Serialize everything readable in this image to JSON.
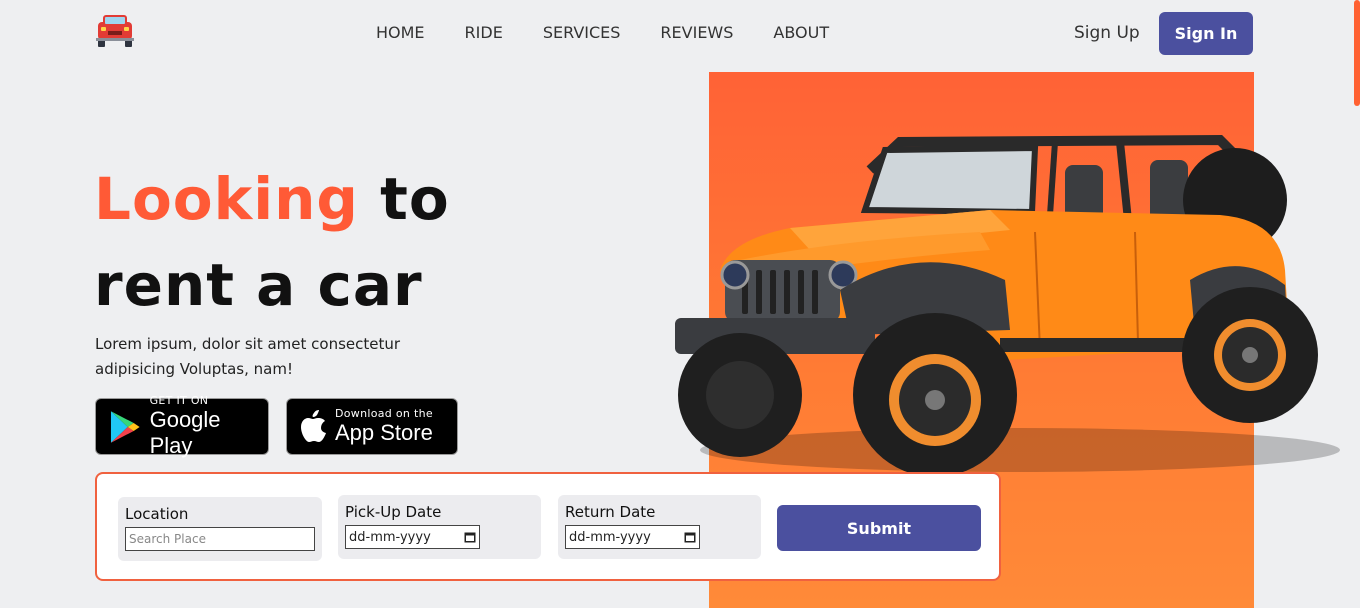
{
  "nav": {
    "items": [
      "HOME",
      "RIDE",
      "SERVICES",
      "REVIEWS",
      "ABOUT"
    ],
    "signup": "Sign Up",
    "signin": "Sign In"
  },
  "hero": {
    "title_accent": "Looking",
    "title_rest1": " to",
    "title_line2": "rent a car",
    "subtitle": "Lorem ipsum, dolor sit amet consectetur adipisicing Voluptas, nam!"
  },
  "stores": {
    "google_small": "GET IT ON",
    "google_big": "Google Play",
    "apple_small": "Download on the",
    "apple_big": "App Store"
  },
  "booking": {
    "location_label": "Location",
    "location_placeholder": "Search Place",
    "pickup_label": "Pick-Up Date",
    "pickup_value": "dd-mm-yyyy",
    "return_label": "Return Date",
    "return_value": "dd-mm-yyyy",
    "submit_label": "Submit"
  },
  "colors": {
    "accent": "#ff5a36",
    "primary": "#4b509f",
    "panel": "#ff6d35"
  }
}
